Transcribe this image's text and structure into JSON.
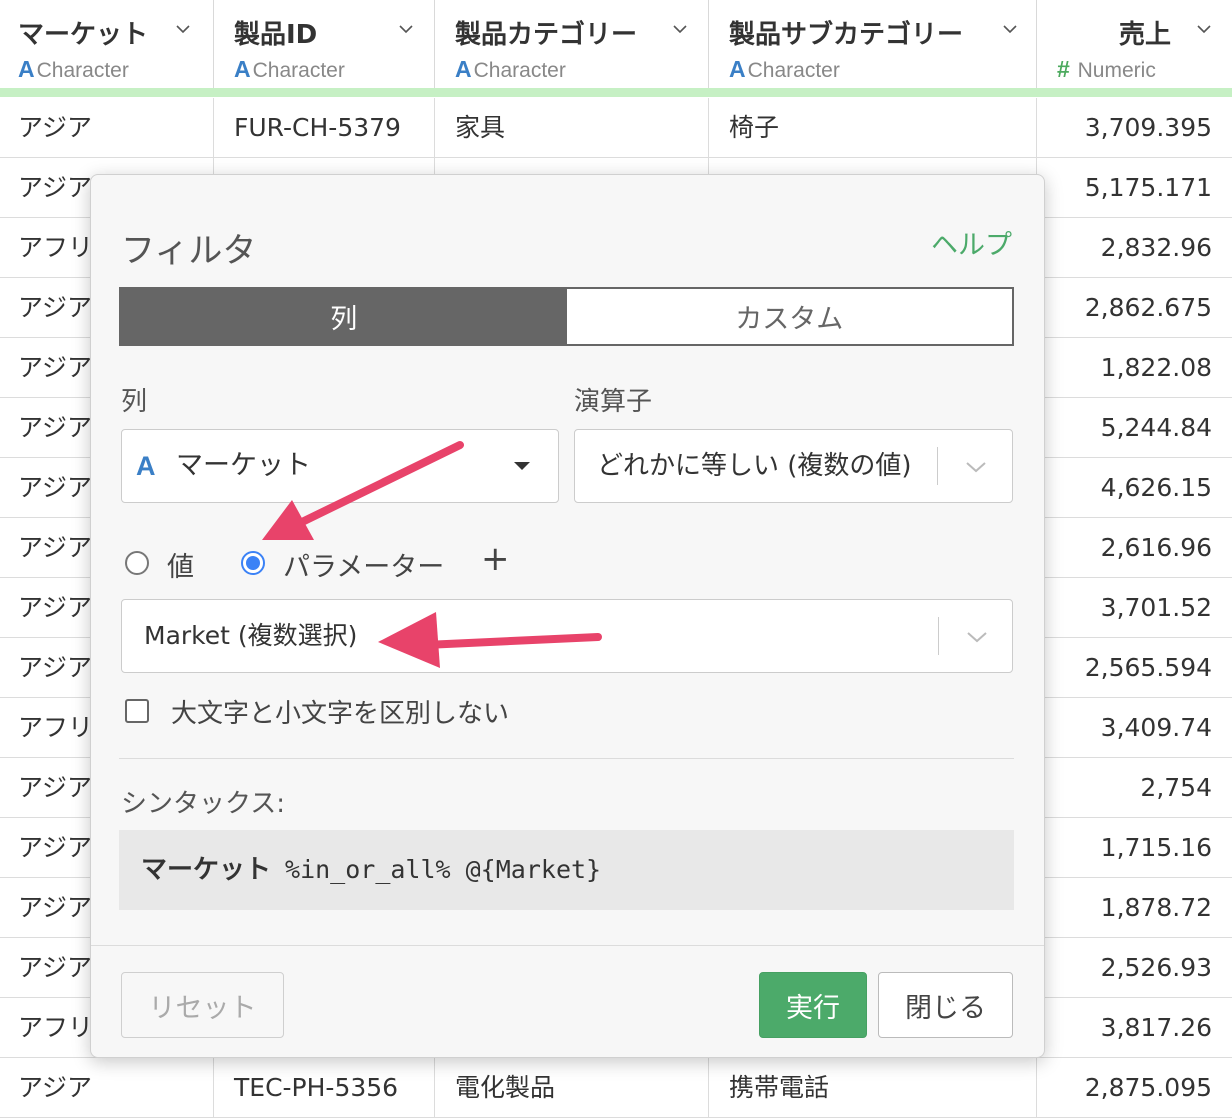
{
  "table": {
    "columns": [
      {
        "name": "マーケット",
        "type": "Character",
        "type_icon": "A"
      },
      {
        "name": "製品ID",
        "type": "Character",
        "type_icon": "A"
      },
      {
        "name": "製品カテゴリー",
        "type": "Character",
        "type_icon": "A"
      },
      {
        "name": "製品サブカテゴリー",
        "type": "Character",
        "type_icon": "A"
      },
      {
        "name": "売上",
        "type": "Numeric",
        "type_icon": "#"
      }
    ],
    "rows": [
      [
        "アジア",
        "FUR-CH-5379",
        "家具",
        "椅子",
        "3,709.395"
      ],
      [
        "アジア",
        "",
        "",
        "",
        "5,175.171"
      ],
      [
        "アフリ",
        "",
        "",
        "",
        "2,832.96"
      ],
      [
        "アジア",
        "",
        "",
        "",
        "2,862.675"
      ],
      [
        "アジア",
        "",
        "",
        "",
        "1,822.08"
      ],
      [
        "アジア",
        "",
        "",
        "",
        "5,244.84"
      ],
      [
        "アジア",
        "",
        "",
        "",
        "4,626.15"
      ],
      [
        "アジア",
        "",
        "",
        "",
        "2,616.96"
      ],
      [
        "アジア",
        "",
        "",
        "",
        "3,701.52"
      ],
      [
        "アジア",
        "",
        "",
        "",
        "2,565.594"
      ],
      [
        "アフリ",
        "",
        "",
        "",
        "3,409.74"
      ],
      [
        "アジア",
        "",
        "",
        "",
        "2,754"
      ],
      [
        "アジア",
        "",
        "",
        "",
        "1,715.16"
      ],
      [
        "アジア",
        "",
        "",
        "",
        "1,878.72"
      ],
      [
        "アジア",
        "",
        "",
        "",
        "2,526.93"
      ],
      [
        "アフリ",
        "",
        "",
        "",
        "3,817.26"
      ],
      [
        "アジア",
        "TEC-PH-5356",
        "電化製品",
        "携帯電話",
        "2,875.095"
      ]
    ]
  },
  "dialog": {
    "title": "フィルタ",
    "help_link": "ヘルプ",
    "tabs": [
      "列",
      "カスタム"
    ],
    "active_tab": "列",
    "column_label": "列",
    "column_value": "マーケット",
    "column_type_icon": "A",
    "operator_label": "演算子",
    "operator_value": "どれかに等しい (複数の値)",
    "value_mode_options": [
      "値",
      "パラメーター"
    ],
    "value_mode_selected": "パラメーター",
    "add_parameter": "+",
    "parameter_value": "Market (複数選択)",
    "ignore_case_label": "大文字と小文字を区別しない",
    "ignore_case_checked": false,
    "syntax_label": "シンタックス:",
    "syntax_column": "マーケット",
    "syntax_code": "%in_or_all% @{Market}",
    "reset_button": "リセット",
    "run_button": "実行",
    "close_button": "閉じる"
  },
  "colors": {
    "accent_green": "#4caa6a",
    "radio_blue": "#3b82f6",
    "annotation_arrow": "#e8436a",
    "header_bar": "#c6f0c4"
  }
}
